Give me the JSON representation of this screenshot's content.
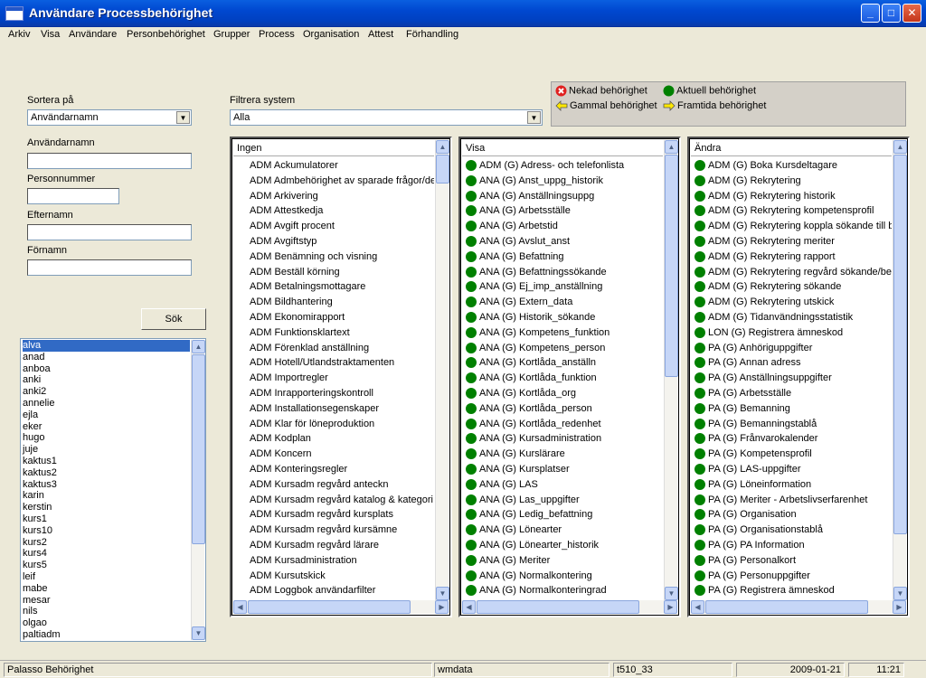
{
  "window": {
    "title": "Användare Processbehörighet"
  },
  "menu": [
    "Arkiv",
    "Visa",
    "Användare",
    "Personbehörighet",
    "Grupper",
    "Process",
    "Organisation",
    "Attest",
    "Förhandling"
  ],
  "left": {
    "sort_label": "Sortera på",
    "sort_value": "Användarnamn",
    "username_label": "Användarnamn",
    "personnummer_label": "Personnummer",
    "efternamn_label": "Efternamn",
    "fornamn_label": "Förnamn",
    "search_button": "Sök",
    "users": [
      "alva",
      "anad",
      "anboa",
      "anki",
      "anki2",
      "annelie",
      "ejla",
      "eker",
      "hugo",
      "juje",
      "kaktus1",
      "kaktus2",
      "kaktus3",
      "karin",
      "kerstin",
      "kurs1",
      "kurs10",
      "kurs2",
      "kurs4",
      "kurs5",
      "leif",
      "mabe",
      "mesar",
      "nils",
      "olgao",
      "paltiadm"
    ],
    "selected_user": "alva"
  },
  "filter": {
    "label": "Filtrera system",
    "value": "Alla"
  },
  "legend": {
    "denied": "Nekad behörighet",
    "current": "Aktuell behörighet",
    "old": "Gammal behörighet",
    "future": "Framtida behörighet",
    "colors": {
      "denied": "#e02020",
      "current": "#008000",
      "arrow": "#ffe800"
    }
  },
  "lists": {
    "ingen": {
      "header": "Ingen",
      "items": [
        "ADM Ackumulatorer",
        "ADM Admbehörighet av sparade frågor/del",
        "ADM Arkivering",
        "ADM Attestkedja",
        "ADM Avgift procent",
        "ADM Avgiftstyp",
        "ADM Benämning och visning",
        "ADM Beställ körning",
        "ADM Betalningsmottagare",
        "ADM Bildhantering",
        "ADM Ekonomirapport",
        "ADM Funktionsklartext",
        "ADM Förenklad anställning",
        "ADM Hotell/Utlandstraktamenten",
        "ADM Importregler",
        "ADM Inrapporteringskontroll",
        "ADM Installationsegenskaper",
        "ADM Klar för löneproduktion",
        "ADM Kodplan",
        "ADM Koncern",
        "ADM Konteringsregler",
        "ADM Kursadm regvård anteckn",
        "ADM Kursadm regvård katalog & kategori",
        "ADM Kursadm regvård kursplats",
        "ADM Kursadm regvård kursämne",
        "ADM Kursadm regvård lärare",
        "ADM Kursadministration",
        "ADM Kursutskick",
        "ADM Loggbok användarfilter"
      ]
    },
    "visa": {
      "header": "Visa",
      "items": [
        "ADM (G) Adress- och telefonlista",
        "ANA (G) Anst_uppg_historik",
        "ANA (G) Anställningsuppg",
        "ANA (G) Arbetsställe",
        "ANA (G) Arbetstid",
        "ANA (G) Avslut_anst",
        "ANA (G) Befattning",
        "ANA (G) Befattningssökande",
        "ANA (G) Ej_imp_anställning",
        "ANA (G) Extern_data",
        "ANA (G) Historik_sökande",
        "ANA (G) Kompetens_funktion",
        "ANA (G) Kompetens_person",
        "ANA (G) Kortlåda_anställn",
        "ANA (G) Kortlåda_funktion",
        "ANA (G) Kortlåda_org",
        "ANA (G) Kortlåda_person",
        "ANA (G) Kortlåda_redenhet",
        "ANA (G) Kursadministration",
        "ANA (G) Kurslärare",
        "ANA (G) Kursplatser",
        "ANA (G) LAS",
        "ANA (G) Las_uppgifter",
        "ANA (G) Ledig_befattning",
        "ANA (G) Lönearter",
        "ANA (G) Lönearter_historik",
        "ANA (G) Meriter",
        "ANA (G) Normalkontering",
        "ANA (G) Normalkonteringrad"
      ]
    },
    "andra": {
      "header": "Ändra",
      "items": [
        "ADM (G) Boka Kursdeltagare",
        "ADM (G) Rekrytering",
        "ADM (G) Rekrytering historik",
        "ADM (G) Rekrytering kompetensprofil",
        "ADM (G) Rekrytering koppla sökande till bef",
        "ADM (G) Rekrytering meriter",
        "ADM (G) Rekrytering rapport",
        "ADM (G) Rekrytering regvård sökande/befa",
        "ADM (G) Rekrytering sökande",
        "ADM (G) Rekrytering utskick",
        "ADM (G) Tidanvändningsstatistik",
        "LON (G) Registrera ämneskod",
        "PA (G) Anhöriguppgifter",
        "PA (G) Annan adress",
        "PA (G) Anställningsuppgifter",
        "PA (G) Arbetsställe",
        "PA (G) Bemanning",
        "PA (G) Bemanningstablå",
        "PA (G) Frånvarokalender",
        "PA (G) Kompetensprofil",
        "PA (G) LAS-uppgifter",
        "PA (G) Löneinformation",
        "PA (G) Meriter - Arbetslivserfarenhet",
        "PA (G) Organisation",
        "PA (G) Organisationstablå",
        "PA (G) PA Information",
        "PA (G) Personalkort",
        "PA (G) Personuppgifter",
        "PA (G) Registrera ämneskod"
      ]
    }
  },
  "status": {
    "app": "Palasso Behörighet",
    "server": "wmdata",
    "db": "t510_33",
    "date": "2009-01-21",
    "time": "11:21"
  }
}
